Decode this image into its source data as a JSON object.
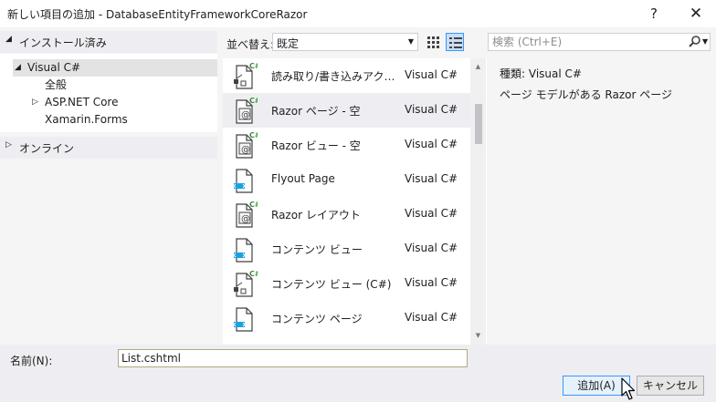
{
  "window": {
    "title": "新しい項目の追加 - DatabaseEntityFrameworkCoreRazor",
    "help_label": "?",
    "close_label": "✕"
  },
  "tree": {
    "installed_label": "インストール済み",
    "online_label": "オンライン",
    "items": [
      {
        "label": "Visual C#"
      },
      {
        "label": "全般"
      },
      {
        "label": "ASP.NET Core"
      },
      {
        "label": "Xamarin.Forms"
      }
    ]
  },
  "toolbar": {
    "sort_label": "並べ替え:",
    "sort_value": "既定"
  },
  "search": {
    "placeholder": "検索 (Ctrl+E)"
  },
  "templates": [
    {
      "name": "読み取り/書き込みアクション...",
      "lang": "Visual C#",
      "icon": "csharp-flow-icon"
    },
    {
      "name": "Razor ページ - 空",
      "lang": "Visual C#",
      "icon": "razor-page-icon"
    },
    {
      "name": "Razor ビュー - 空",
      "lang": "Visual C#",
      "icon": "razor-view-icon"
    },
    {
      "name": "Flyout Page",
      "lang": "Visual C#",
      "icon": "xaml-page-icon"
    },
    {
      "name": "Razor レイアウト",
      "lang": "Visual C#",
      "icon": "razor-layout-icon"
    },
    {
      "name": "コンテンツ ビュー",
      "lang": "Visual C#",
      "icon": "xaml-view-icon"
    },
    {
      "name": "コンテンツ ビュー (C#)",
      "lang": "Visual C#",
      "icon": "csharp-flow-icon"
    },
    {
      "name": "コンテンツ ページ",
      "lang": "Visual C#",
      "icon": "xaml-page-icon"
    }
  ],
  "details": {
    "type_label": "種類:",
    "type_value": "Visual C#",
    "description": "ページ モデルがある Razor ページ"
  },
  "footer": {
    "name_label": "名前(N):",
    "name_value": "List.cshtml",
    "add_label": "追加(A)",
    "cancel_label": "キャンセル"
  },
  "colors": {
    "accent": "#3399ff",
    "csharp_green": "#388a34",
    "xaml_blue": "#1ba1e2"
  }
}
